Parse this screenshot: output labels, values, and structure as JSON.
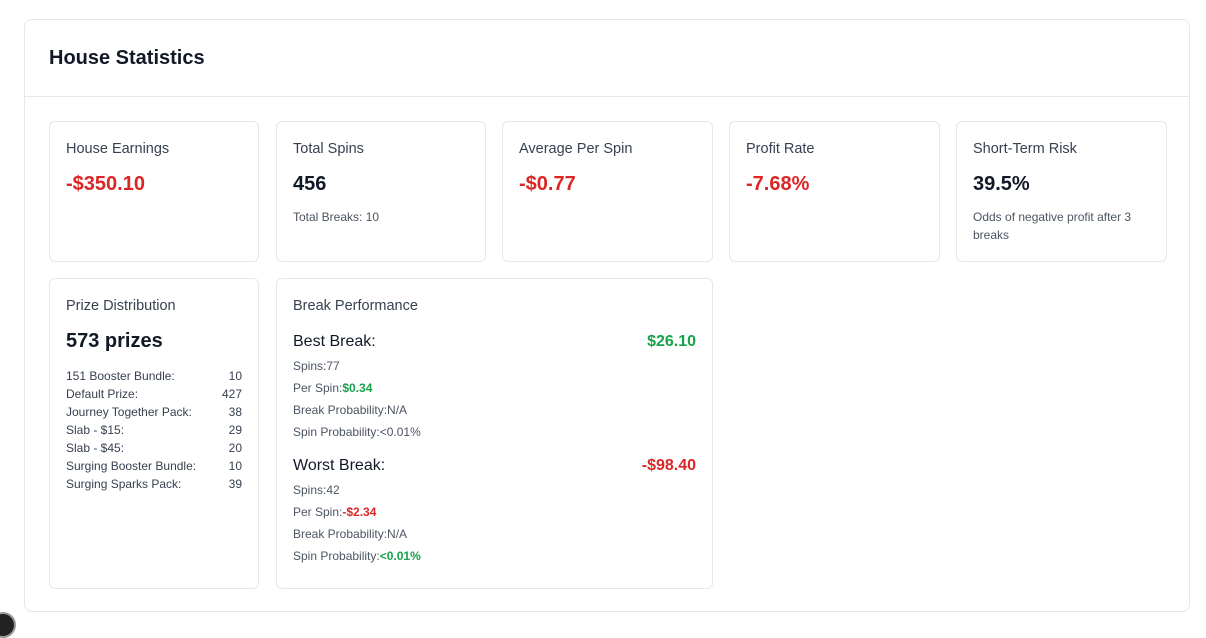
{
  "panel": {
    "title": "House Statistics"
  },
  "stats": {
    "house_earnings": {
      "label": "House Earnings",
      "value": "-$350.10"
    },
    "total_spins": {
      "label": "Total Spins",
      "value": "456",
      "sub": "Total Breaks: 10"
    },
    "average_per_spin": {
      "label": "Average Per Spin",
      "value": "-$0.77"
    },
    "profit_rate": {
      "label": "Profit Rate",
      "value": "-7.68%"
    },
    "short_term_risk": {
      "label": "Short-Term Risk",
      "value": "39.5%",
      "sub": "Odds of negative profit after 3 breaks"
    }
  },
  "prize_distribution": {
    "label": "Prize Distribution",
    "total": "573 prizes",
    "items": [
      {
        "name": "151 Booster Bundle:",
        "count": "10"
      },
      {
        "name": "Default Prize:",
        "count": "427"
      },
      {
        "name": "Journey Together Pack:",
        "count": "38"
      },
      {
        "name": "Slab - $15:",
        "count": "29"
      },
      {
        "name": "Slab - $45:",
        "count": "20"
      },
      {
        "name": "Surging Booster Bundle:",
        "count": "10"
      },
      {
        "name": "Surging Sparks Pack:",
        "count": "39"
      }
    ]
  },
  "break_performance": {
    "label": "Break Performance",
    "best": {
      "title": "Best Break:",
      "value": "$26.10",
      "spins_label": "Spins:",
      "spins": "77",
      "per_spin_label": "Per Spin:",
      "per_spin": "$0.34",
      "break_prob_label": "Break Probability:",
      "break_prob": "N/A",
      "spin_prob_label": "Spin Probability:",
      "spin_prob": "<0.01%"
    },
    "worst": {
      "title": "Worst Break:",
      "value": "-$98.40",
      "spins_label": "Spins:",
      "spins": "42",
      "per_spin_label": "Per Spin:",
      "per_spin": "-$2.34",
      "break_prob_label": "Break Probability:",
      "break_prob": "N/A",
      "spin_prob_label": "Spin Probability:",
      "spin_prob": "<0.01%"
    }
  },
  "colors": {
    "negative": "#dc2626",
    "positive": "#16a34a",
    "border": "#e5e7eb"
  }
}
